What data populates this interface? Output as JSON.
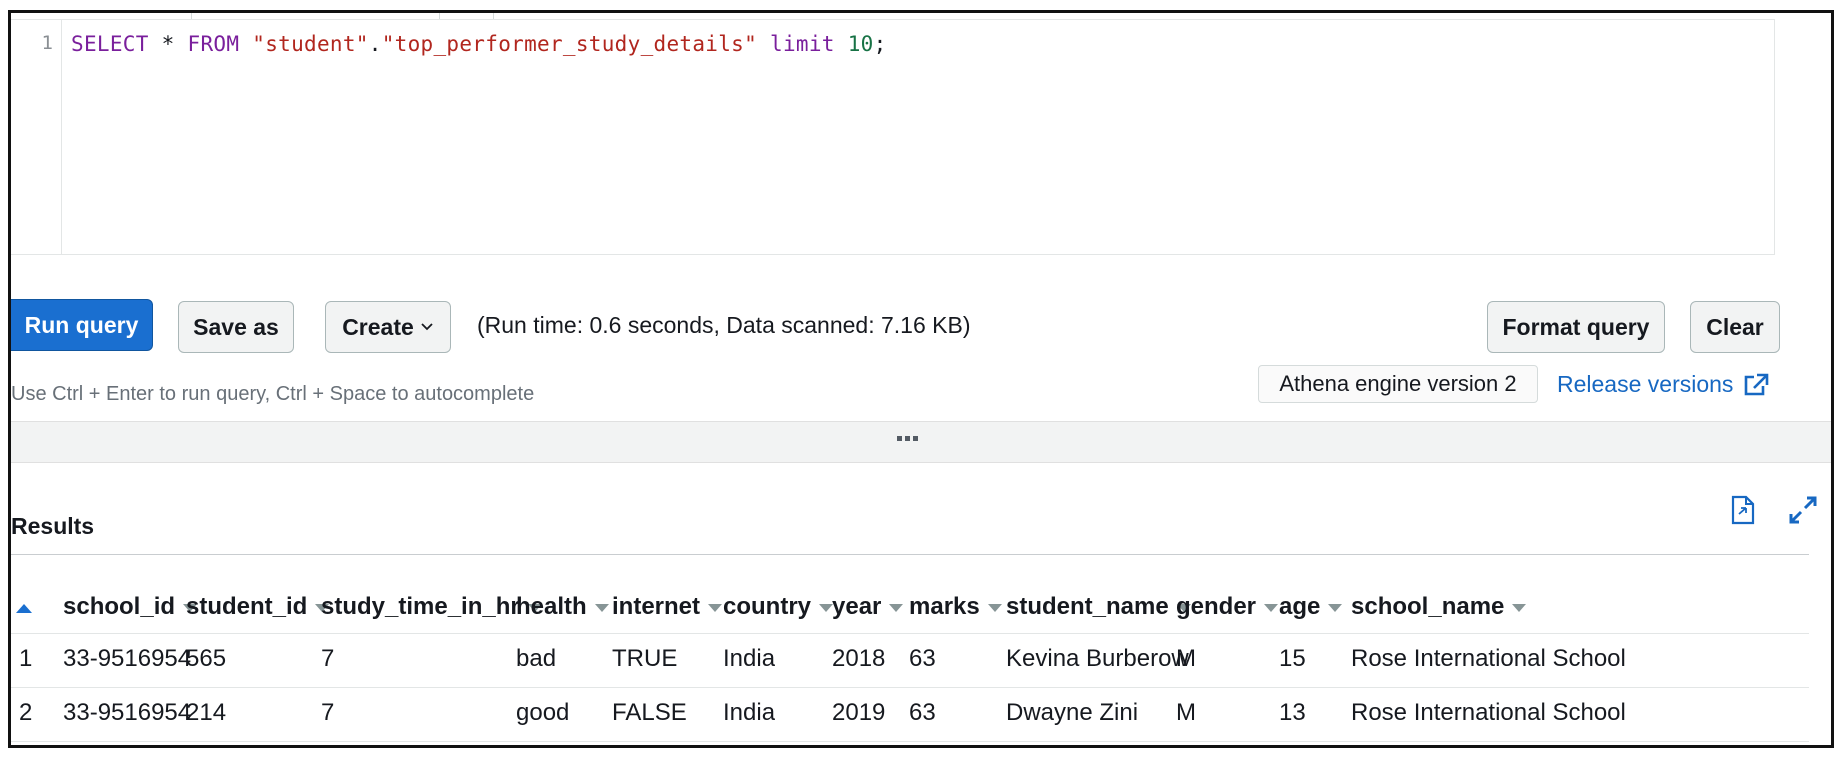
{
  "editor": {
    "line_number": "1",
    "query_tokens": [
      {
        "text": "SELECT",
        "kind": "kw"
      },
      {
        "text": " * ",
        "kind": "op"
      },
      {
        "text": "FROM",
        "kind": "kw"
      },
      {
        "text": " ",
        "kind": "op"
      },
      {
        "text": "\"student\"",
        "kind": "str"
      },
      {
        "text": ".",
        "kind": "op"
      },
      {
        "text": "\"top_performer_study_details\"",
        "kind": "str"
      },
      {
        "text": " ",
        "kind": "op"
      },
      {
        "text": "limit",
        "kind": "kw"
      },
      {
        "text": " ",
        "kind": "op"
      },
      {
        "text": "10",
        "kind": "num"
      },
      {
        "text": ";",
        "kind": "op"
      }
    ]
  },
  "toolbar": {
    "run_label": "Run query",
    "save_as_label": "Save as",
    "create_label": "Create",
    "run_info": "(Run time: 0.6 seconds, Data scanned: 7.16 KB)",
    "format_label": "Format query",
    "clear_label": "Clear",
    "hint": "Use Ctrl + Enter to run query, Ctrl + Space to autocomplete",
    "engine": "Athena engine version 2",
    "release_link": "Release versions"
  },
  "results": {
    "title": "Results",
    "columns": [
      "school_id",
      "student_id",
      "study_time_in_hr",
      "health",
      "internet",
      "country",
      "year",
      "marks",
      "student_name",
      "gender",
      "age",
      "school_name"
    ],
    "rows": [
      [
        "1",
        "33-9516954",
        "565",
        "7",
        "bad",
        "TRUE",
        "India",
        "2018",
        "63",
        "Kevina Burberow",
        "M",
        "15",
        "Rose International School"
      ],
      [
        "2",
        "33-9516954",
        "214",
        "7",
        "good",
        "FALSE",
        "India",
        "2019",
        "63",
        "Dwayne Zini",
        "M",
        "13",
        "Rose International School"
      ]
    ]
  },
  "colors": {
    "primary": "#1a6fd0",
    "link": "#1768c2",
    "keyword": "#7a1f9c",
    "string": "#b1261e",
    "number": "#177245"
  },
  "icons": [
    "chevron-down-icon",
    "external-link-icon",
    "download-file-icon",
    "expand-icon",
    "sort-ascending-icon",
    "caret-down-icon",
    "drag-handle-icon"
  ]
}
